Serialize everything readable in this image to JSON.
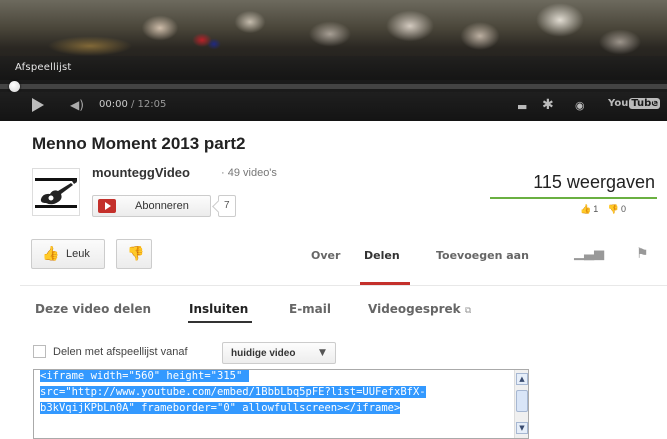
{
  "player": {
    "playlist_label": "Afspeellijst",
    "time_current": "00:00",
    "time_total": " / 12:05",
    "progress": 0.0,
    "logo_text": "You",
    "logo_box": "Tube"
  },
  "video": {
    "title": "Menno Moment 2013 part2",
    "channel": "mounteggVideo",
    "video_count": "· 49 video's",
    "subscribe_label": "Abonneren",
    "subscriber_count": "7",
    "views": "115 weergaven",
    "likes": "1",
    "dislikes": "0"
  },
  "actions": {
    "like_label": "Leuk",
    "tabs": [
      "Over",
      "Delen",
      "Toevoegen aan"
    ],
    "active_tab": "Delen"
  },
  "share": {
    "subtabs": [
      "Deze video delen",
      "Insluiten",
      "E-mail",
      "Videogesprek"
    ],
    "active_subtab": "Insluiten",
    "playlist_option_label": "Delen met afspeellijst vanaf",
    "playlist_option_value": "huidige video",
    "embed_code": "<iframe width=\"560\" height=\"315\" src=\"http://www.youtube.com/embed/1BbbLbq5pFE?list=UUFefxBfX-b3kVqijKPbLn0A\" frameborder=\"0\" allowfullscreen></iframe>"
  },
  "colors": {
    "brand_red": "#c4302b",
    "views_bar": "#6ab041",
    "selection": "#3399ff"
  }
}
